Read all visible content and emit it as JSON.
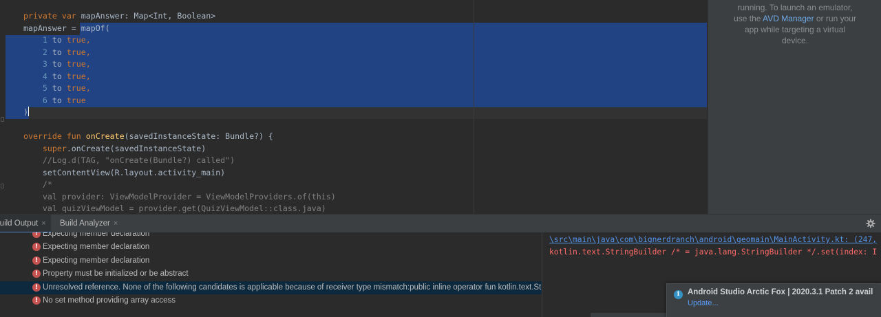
{
  "editor": {
    "lines": [
      [
        {
          "t": "private var ",
          "c": "kw"
        },
        {
          "t": "mapAnswer: Map<Int, Boolean>"
        }
      ],
      [
        {
          "t": "mapAnswer = "
        },
        {
          "t": "mapOf("
        }
      ],
      [
        {
          "t": "    "
        },
        {
          "t": "1",
          "c": "num"
        },
        {
          "t": " to "
        },
        {
          "t": "true",
          "c": "kw"
        },
        {
          "t": ",",
          "c": "kw"
        }
      ],
      [
        {
          "t": "    "
        },
        {
          "t": "2",
          "c": "num"
        },
        {
          "t": " to "
        },
        {
          "t": "true",
          "c": "kw"
        },
        {
          "t": ",",
          "c": "kw"
        }
      ],
      [
        {
          "t": "    "
        },
        {
          "t": "3",
          "c": "num"
        },
        {
          "t": " to "
        },
        {
          "t": "true",
          "c": "kw"
        },
        {
          "t": ",",
          "c": "kw"
        }
      ],
      [
        {
          "t": "    "
        },
        {
          "t": "4",
          "c": "num"
        },
        {
          "t": " to "
        },
        {
          "t": "true",
          "c": "kw"
        },
        {
          "t": ",",
          "c": "kw"
        }
      ],
      [
        {
          "t": "    "
        },
        {
          "t": "5",
          "c": "num"
        },
        {
          "t": " to "
        },
        {
          "t": "true",
          "c": "kw"
        },
        {
          "t": ",",
          "c": "kw"
        }
      ],
      [
        {
          "t": "    "
        },
        {
          "t": "6",
          "c": "num"
        },
        {
          "t": " to "
        },
        {
          "t": "true",
          "c": "kw"
        }
      ],
      [
        {
          "t": ")"
        },
        {
          "caret": true
        }
      ],
      [],
      [
        {
          "t": "override fun ",
          "c": "kw"
        },
        {
          "t": "onCreate",
          "c": "fn"
        },
        {
          "t": "(savedInstanceState: Bundle?) {"
        }
      ],
      [
        {
          "t": "    "
        },
        {
          "t": "super",
          "c": "kw"
        },
        {
          "t": ".onCreate(savedInstanceState)"
        }
      ],
      [
        {
          "t": "    "
        },
        {
          "t": "//Log.d(TAG, \"onCreate(Bundle?) called\")",
          "c": "cm"
        }
      ],
      [
        {
          "t": "    setContentView(R.layout.activity_main)"
        }
      ],
      [
        {
          "t": "    "
        },
        {
          "t": "/*",
          "c": "cm"
        }
      ],
      [
        {
          "t": "    val provider: ViewModelProvider = ViewModelProviders.of(this)",
          "c": "cm"
        }
      ],
      [
        {
          "t": "    val quizViewModel = provider.get(QuizViewModel::class.java)",
          "c": "cm"
        }
      ]
    ]
  },
  "emulator_panel": {
    "line1": "running. To launch an emulator,",
    "line2_prefix": "use the ",
    "link": "AVD Manager",
    "line2_suffix": " or run your",
    "line3": "app while targeting a virtual",
    "line4": "device."
  },
  "tool_window": {
    "tabs": [
      {
        "label": "Build Output",
        "close": "×"
      },
      {
        "label": "Build Analyzer",
        "close": "×"
      }
    ],
    "gear_icon": "settings-gear-icon"
  },
  "build_output": {
    "rows": [
      {
        "text": "Expecting member declaration",
        "selected": false
      },
      {
        "text": "Expecting member declaration",
        "selected": false
      },
      {
        "text": "Expecting member declaration",
        "selected": false
      },
      {
        "text": "Property must be initialized or be abstract",
        "selected": false
      },
      {
        "text": "Unresolved reference. None of the following candidates is applicable because of receiver type mismatch:public inline operator fun kotlin.text.StringBuilde",
        "selected": true
      },
      {
        "text": "No set method providing array access",
        "selected": false
      }
    ]
  },
  "detail": {
    "path": "\\src\\main\\java\\com\\bignerdranch\\android\\geomain\\MainActivity.kt: (247,",
    "message": "kotlin.text.StringBuilder /* = java.lang.StringBuilder */.set(index: I"
  },
  "notification": {
    "title": "Android Studio Arctic Fox | 2020.3.1 Patch 2 avail",
    "link": "Update..."
  },
  "colors": {
    "selection": "#214283",
    "error": "#c75450",
    "link": "#589df6",
    "keyword": "#cc7832",
    "number": "#6897bb"
  }
}
